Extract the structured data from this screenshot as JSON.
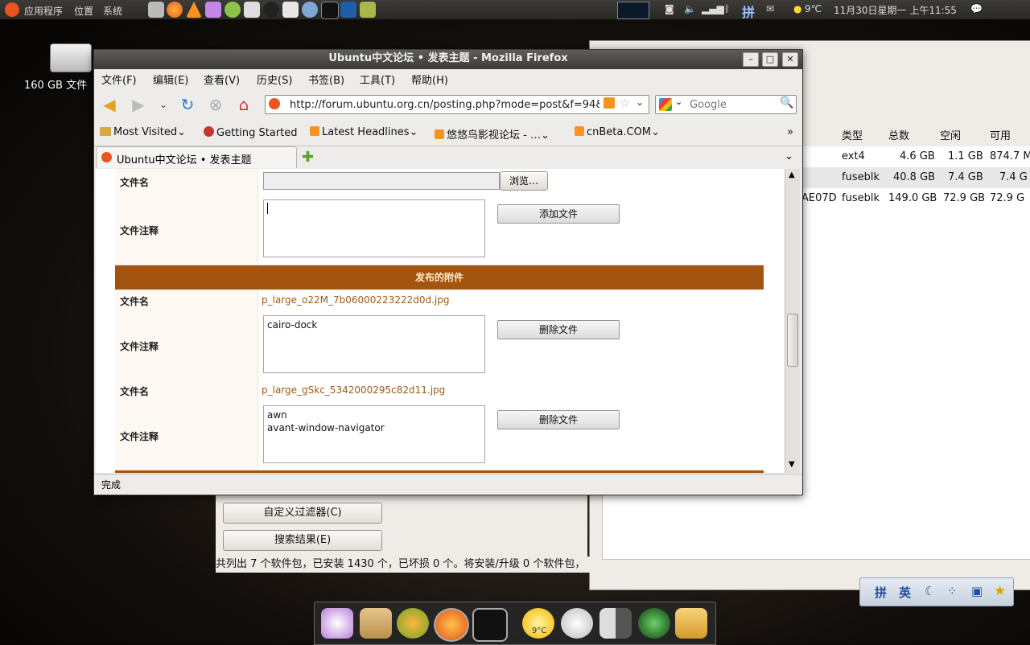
{
  "top_panel": {
    "menu_applications": "应用程序",
    "menu_places": "位置",
    "menu_system": "系统",
    "ime_indicator": "拼",
    "weather": "9℃",
    "clock": "11月30日星期一 上午11:55"
  },
  "desktop": {
    "drive_label": "160 GB 文件"
  },
  "firefox": {
    "title": "Ubuntu中文论坛 • 发表主题 - Mozilla Firefox",
    "menus": [
      "文件(F)",
      "编辑(E)",
      "查看(V)",
      "历史(S)",
      "书签(B)",
      "工具(T)",
      "帮助(H)"
    ],
    "url": "http://forum.ubuntu.org.cn/posting.php?mode=post&f=94&",
    "search_placeholder": "Google",
    "bookmarks": [
      "Most Visited",
      "Getting Started",
      "Latest Headlines",
      "悠悠鸟影视论坛 - …",
      "cnBeta.COM"
    ],
    "tab_title": "Ubuntu中文论坛 • 发表主题",
    "status": "完成"
  },
  "form": {
    "filename_label": "文件名",
    "comment_label": "文件注释",
    "browse_button": "浏览…",
    "add_file_button": "添加文件",
    "delete_file_button": "删除文件",
    "attachments_header": "发布的附件",
    "attachments": [
      {
        "filename": "p_large_o22M_7b06000223222d0d.jpg",
        "comment_lines": [
          "cairo-dock"
        ]
      },
      {
        "filename": "p_large_gSkc_5342000295c82d11.jpg",
        "comment_lines": [
          "awn",
          "avant-window-navigator"
        ]
      }
    ]
  },
  "disk_window": {
    "headers": [
      "类型",
      "总数",
      "空闲",
      "可用"
    ],
    "rows": [
      {
        "device": "",
        "type": "ext4",
        "total": "4.6 GB",
        "free": "1.1 GB",
        "avail": "874.7 M"
      },
      {
        "device": "",
        "type": "fuseblk",
        "total": "40.8 GB",
        "free": "7.4 GB",
        "avail": "7.4 G"
      },
      {
        "device": "AE07D",
        "type": "fuseblk",
        "total": "149.0 GB",
        "free": "72.9 GB",
        "avail": "72.9 G"
      }
    ]
  },
  "synaptic": {
    "custom_filter_button": "自定义过滤器(C)",
    "search_results_button": "搜索结果(E)",
    "status": "共列出 7 个软件包，已安装 1430 个，已坏损 0 个。将安装/升级 0 个软件包，"
  },
  "ime_bar": {
    "items": [
      "拼",
      "英"
    ]
  },
  "dock": {
    "weather": "9°C"
  },
  "colors": {
    "accent_band": "#a35510",
    "link": "#a05a14",
    "panel": "#3c3b37"
  }
}
